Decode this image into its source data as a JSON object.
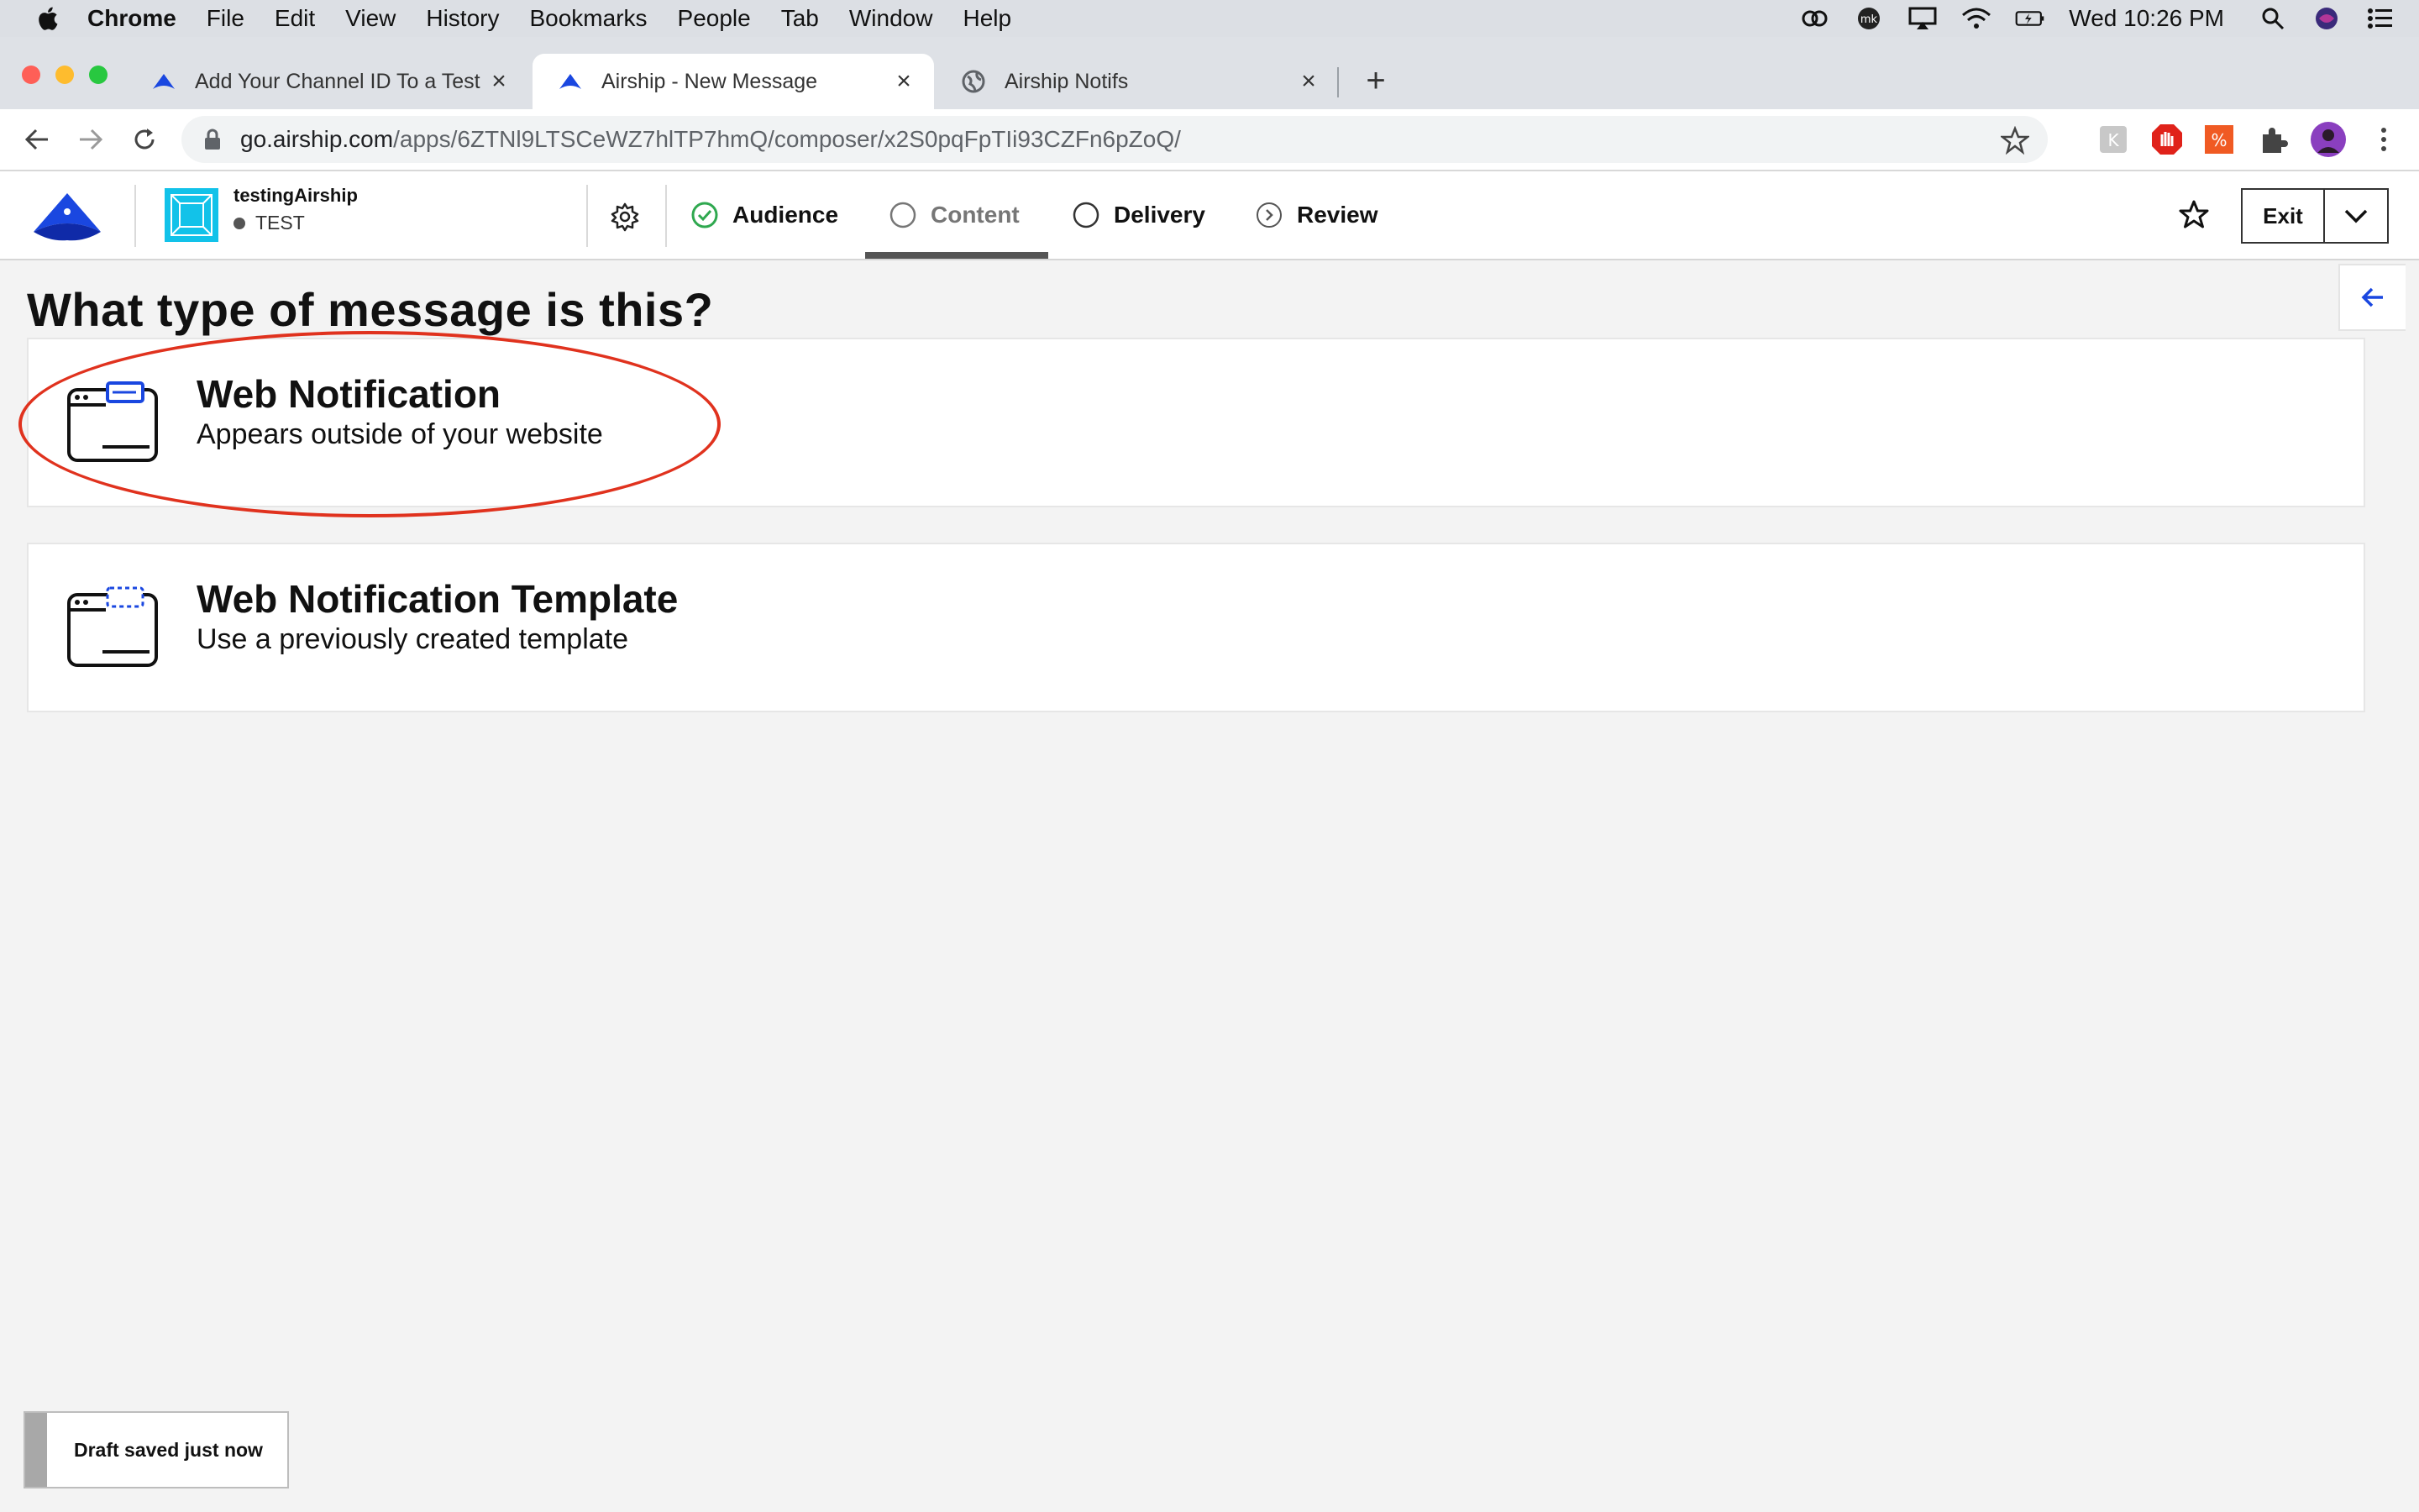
{
  "menubar": {
    "app": "Chrome",
    "items": [
      "File",
      "Edit",
      "View",
      "History",
      "Bookmarks",
      "People",
      "Tab",
      "Window",
      "Help"
    ],
    "clock": "Wed 10:26 PM"
  },
  "tabs": [
    {
      "title": "Add Your Channel ID To a Test",
      "icon": "airship-logo-icon"
    },
    {
      "title": "Airship - New Message",
      "icon": "airship-logo-icon"
    },
    {
      "title": "Airship Notifs",
      "icon": "globe-icon"
    }
  ],
  "omnibox": {
    "host": "go.airship.com",
    "path": "/apps/6ZTNl9LTSCeWZ7hlTP7hmQ/composer/x2S0pqFpTIi93CZFn6pZoQ/"
  },
  "app": {
    "name": "testingAirship",
    "env": "TEST"
  },
  "steps": [
    {
      "label": "Audience",
      "state": "complete"
    },
    {
      "label": "Content",
      "state": "current"
    },
    {
      "label": "Delivery",
      "state": "pending"
    },
    {
      "label": "Review",
      "state": "pending"
    }
  ],
  "header": {
    "exit_label": "Exit"
  },
  "main": {
    "title": "What type of message is this?",
    "options": [
      {
        "title": "Web Notification",
        "subtitle": "Appears outside of your website"
      },
      {
        "title": "Web Notification Template",
        "subtitle": "Use a previously created template"
      }
    ]
  },
  "toast": {
    "message": "Draft saved just now"
  },
  "colors": {
    "brand_blue": "#1a47e0",
    "annotation_red": "#e0321e",
    "app_icon": "#12c2e9",
    "complete_green": "#2fa84f"
  }
}
